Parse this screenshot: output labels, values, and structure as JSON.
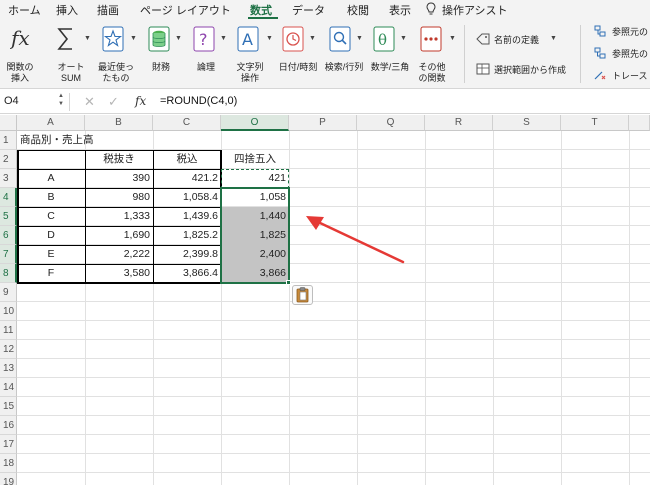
{
  "menu": {
    "tabs": [
      "ホーム",
      "挿入",
      "描画",
      "ページ レイアウト",
      "数式",
      "データ",
      "校閲",
      "表示",
      "操作アシスト"
    ],
    "active_index": 4
  },
  "ribbon": {
    "insert_function": "関数の\n挿入",
    "autosum": "オート\nSUM",
    "recent": "最近使っ\nたもの",
    "financial": "財務",
    "logical": "論理",
    "text": "文字列\n操作",
    "datetime": "日付/時刻",
    "lookup": "検索/行列",
    "math": "数学/三角",
    "more": "その他\nの関数",
    "define_name": "名前の定義",
    "create_from_selection": "選択範囲から作成",
    "trace_precedents": "参照元の",
    "trace_dependents": "参照先の",
    "trace_remove": "トレース"
  },
  "formula_bar": {
    "name_box": "O4",
    "fx": "fx",
    "formula": "=ROUND(C4,0)"
  },
  "columns": [
    "A",
    "B",
    "C",
    "O",
    "P",
    "Q",
    "R",
    "S",
    "T"
  ],
  "rows": [
    "1",
    "2",
    "3",
    "4",
    "5",
    "6",
    "7",
    "8",
    "9",
    "10",
    "11",
    "12",
    "13",
    "14",
    "15",
    "16",
    "17",
    "18",
    "19"
  ],
  "sheet": {
    "title": "商品別・売上高",
    "headers": [
      "",
      "税抜き",
      "税込",
      "四捨五入"
    ],
    "data_rows": [
      [
        "A",
        "390",
        "421.2",
        "421"
      ],
      [
        "B",
        "980",
        "1,058.4",
        "1,058"
      ],
      [
        "C",
        "1,333",
        "1,439.6",
        "1,440"
      ],
      [
        "D",
        "1,690",
        "1,825.2",
        "1,825"
      ],
      [
        "E",
        "2,222",
        "2,399.8",
        "2,400"
      ],
      [
        "F",
        "3,580",
        "3,866.4",
        "3,866"
      ]
    ]
  },
  "icons": {
    "fx": "function-icon",
    "sum": "sigma-icon",
    "recent": "star-icon",
    "financial": "database-icon",
    "logical": "question-book-icon",
    "text": "letter-a-book-icon",
    "datetime": "clock-book-icon",
    "lookup": "magnifier-book-icon",
    "math": "theta-book-icon",
    "more": "dots-book-icon",
    "define_name": "tag-icon",
    "create_sel": "table-icon",
    "paste_options": "clipboard-icon",
    "annotation": "red-arrow"
  },
  "colors": {
    "accent": "#1e7145",
    "ribbon_bg": "#f3f3f3",
    "header_bg": "#f0f0f0",
    "fill_gray": "#c4c4c4",
    "arrow_red": "#e53935"
  }
}
